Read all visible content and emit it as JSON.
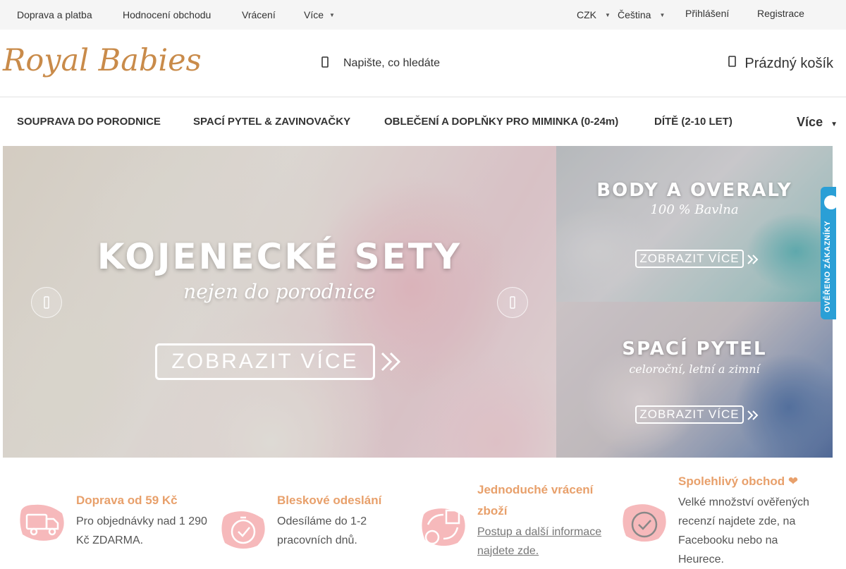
{
  "topbar": {
    "links": [
      "Doprava a platba",
      "Hodnocení obchodu",
      "Vrácení",
      "Více"
    ],
    "currency": "CZK",
    "language": "Čeština",
    "login": "Přihlášení",
    "register": "Registrace"
  },
  "header": {
    "logo": "Royal Babies",
    "search_placeholder": "Napište, co hledáte",
    "cart": "Prázdný košík"
  },
  "nav": {
    "items": [
      "SOUPRAVA DO PORODNICE",
      "SPACÍ PYTEL & ZAVINOVAČKY",
      "OBLEČENÍ A DOPLŇKY PRO MIMINKA (0-24m)",
      "DÍTĚ (2-10 LET)"
    ],
    "more": "Více"
  },
  "banner": {
    "title": "KOJENECKÉ SETY",
    "subtitle": "nejen do porodnice",
    "button": "ZOBRAZIT VÍCE"
  },
  "side_banners": [
    {
      "title": "BODY A OVERALY",
      "subtitle": "100 % Bavlna",
      "button": "ZOBRAZIT VÍCE"
    },
    {
      "title": "SPACÍ PYTEL",
      "subtitle": "celoroční, letní a zimní",
      "button": "ZOBRAZIT VÍCE"
    }
  ],
  "verified_tab": "OVĚŘENO ZÁKAZNÍKY",
  "features": [
    {
      "title": "Doprava od 59 Kč",
      "desc": [
        "Pro objednávky nad 1 290",
        "Kč ZDARMA."
      ]
    },
    {
      "title": "Bleskové odeslání",
      "desc": [
        "Odesíláme do 1-2",
        "pracovních dnů."
      ]
    },
    {
      "title": [
        "Jednoduché vrácení",
        "zboží"
      ],
      "desc": [
        "Postup a další informace",
        "najdete zde."
      ]
    },
    {
      "title": "Spolehlivý obchod ❤",
      "desc": [
        "Velké množství ověřených",
        "recenzí najdete zde, na",
        "Facebooku nebo na",
        "Heurece."
      ]
    }
  ],
  "colors": {
    "accent": "#e8a06b",
    "logo": "#c98b4a",
    "icon_bg": "#f6b9bb",
    "verified": "#2a9fd6"
  }
}
